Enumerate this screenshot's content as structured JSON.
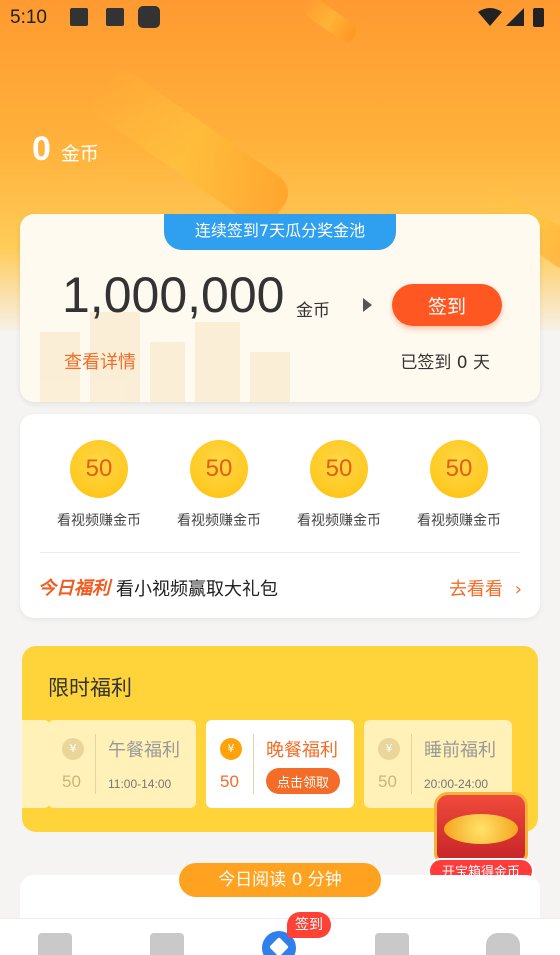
{
  "status_bar": {
    "time": "5:10"
  },
  "balance": {
    "amount": "0",
    "unit": "金币"
  },
  "signin_card": {
    "banner": "连续签到7天瓜分奖金池",
    "pool_amount": "1,000,000",
    "pool_unit": "金币",
    "sign_button": "签到",
    "detail_link": "查看详情",
    "signed_days": "已签到 0 天"
  },
  "tasks": {
    "items": [
      {
        "coins": "50",
        "label": "看视频赚金币"
      },
      {
        "coins": "50",
        "label": "看视频赚金币"
      },
      {
        "coins": "50",
        "label": "看视频赚金币"
      },
      {
        "coins": "50",
        "label": "看视频赚金币"
      }
    ],
    "welfare_tag": "今日福利",
    "welfare_text": "看小视频赢取大礼包",
    "goto_label": "去看看"
  },
  "limited": {
    "title": "限时福利",
    "coin_symbol": "¥",
    "meals": [
      {
        "name": "午餐福利",
        "coins": "50",
        "time": "11:00-14:00",
        "active": false
      },
      {
        "name": "晚餐福利",
        "coins": "50",
        "claim": "点击领取",
        "active": true
      },
      {
        "name": "睡前福利",
        "coins": "50",
        "time": "20:00-24:00",
        "active": false
      }
    ]
  },
  "treasure": {
    "label": "开宝箱得金币"
  },
  "reading": {
    "label": "今日阅读 0 分钟"
  },
  "bottom_nav": {
    "badge": "签到"
  },
  "colors": {
    "accent": "#ff5722",
    "blue": "#2f9ff0",
    "yellow": "#ffd43b"
  }
}
